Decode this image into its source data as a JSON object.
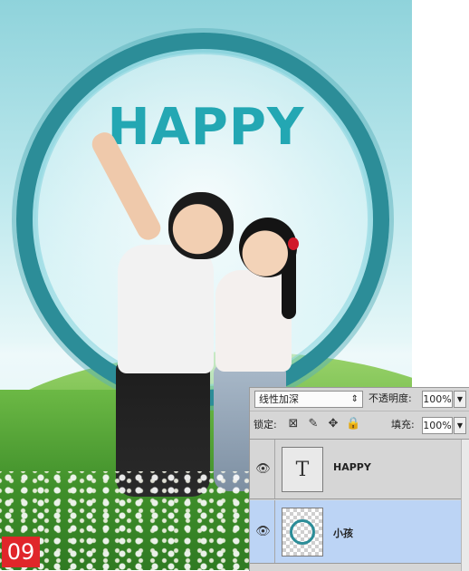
{
  "artwork": {
    "headline": "HAPPY",
    "step_badge": "09",
    "colors": {
      "ring": "#2c8d98",
      "headline": "#23a7b3",
      "badge": "#e0262a",
      "selected_layer": "#bcd4f5"
    }
  },
  "layers_panel": {
    "blend_mode": "线性加深",
    "opacity_label": "不透明度:",
    "opacity_value": "100%",
    "lock_label": "锁定:",
    "fill_label": "填充:",
    "fill_value": "100%",
    "lock_icons": [
      "lock-transparent-icon",
      "lock-brush-icon",
      "lock-move-icon",
      "lock-all-icon"
    ],
    "layers": [
      {
        "name": "HAPPY",
        "thumbnail": "T",
        "type": "text",
        "visible": true,
        "selected": false
      },
      {
        "name": "小孩",
        "thumbnail": "",
        "type": "image",
        "visible": true,
        "selected": true
      }
    ]
  }
}
